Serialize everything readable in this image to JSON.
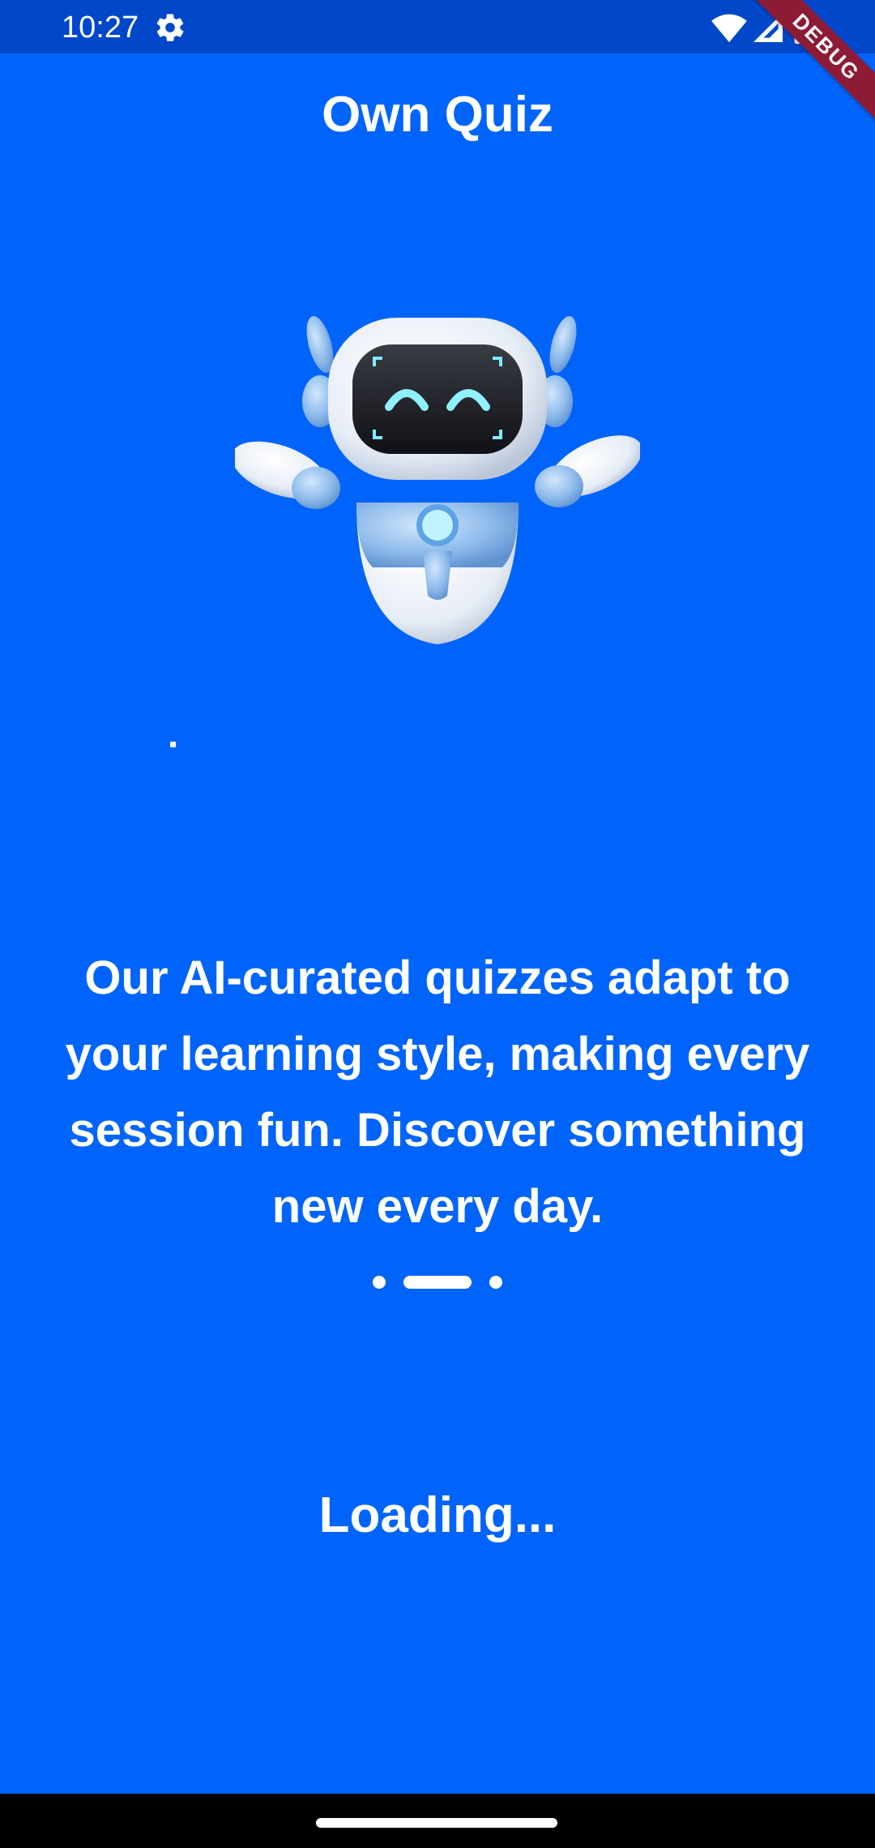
{
  "status_bar": {
    "time": "10:27",
    "icons": [
      "gear-icon",
      "wifi-icon",
      "signal-icon",
      "battery-icon"
    ]
  },
  "debug_banner": "DEBUG",
  "app": {
    "title": "Own Quiz",
    "illustration": "robot-mascot-icon",
    "description": "Our AI-curated quizzes adapt to your learning style, making every session fun. Discover something new every day.",
    "page_indicator": {
      "count": 3,
      "active_index": 1
    },
    "loading_text": "Loading..."
  },
  "colors": {
    "background": "#0064FB",
    "status_bar": "#0047C9",
    "debug_ribbon": "#8E1B36",
    "text": "#FFFFFF"
  }
}
